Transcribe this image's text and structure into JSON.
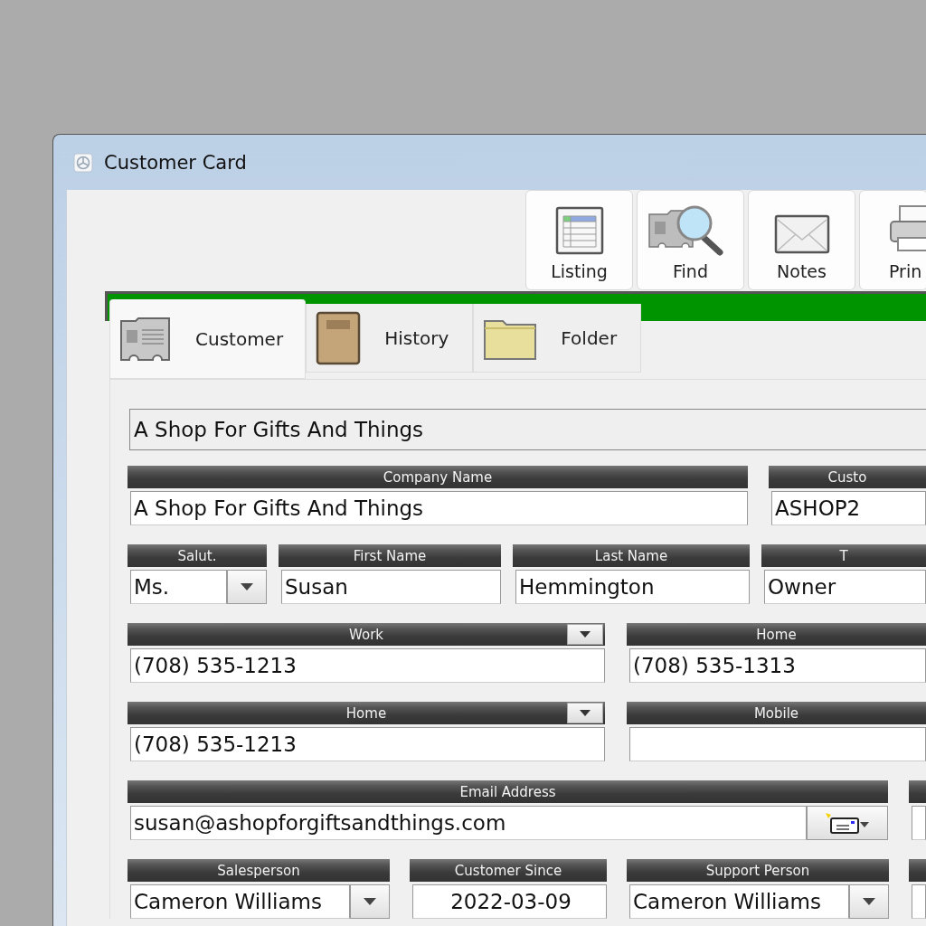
{
  "window": {
    "title": "Customer Card"
  },
  "toolbar": [
    {
      "label": "Listing",
      "kind": "listing"
    },
    {
      "label": "Find",
      "kind": "find"
    },
    {
      "label": "Notes",
      "kind": "notes"
    },
    {
      "label": "Prin",
      "kind": "print"
    }
  ],
  "tabs": [
    {
      "label": "Customer",
      "kind": "card",
      "selected": true
    },
    {
      "label": "History",
      "kind": "book",
      "selected": false
    },
    {
      "label": "Folder",
      "kind": "folder",
      "selected": false
    }
  ],
  "display_name": "A Shop For Gifts And Things",
  "rows": [
    [
      {
        "label": "Company Name",
        "value": "A Shop For Gifts And Things",
        "kind": "text"
      },
      {
        "label": "Custo",
        "value": "ASHOP2",
        "kind": "text"
      }
    ],
    [
      {
        "label": "Salut.",
        "value": "Ms.",
        "kind": "dropdown"
      },
      {
        "label": "First Name",
        "value": "Susan",
        "kind": "text"
      },
      {
        "label": "Last Name",
        "value": "Hemmington",
        "kind": "text"
      },
      {
        "label": "T",
        "value": "Owner",
        "kind": "text"
      }
    ],
    [
      {
        "label": "Work",
        "value": "(708) 535-1213",
        "kind": "text",
        "label_dropdown": true
      },
      {
        "label": "Home",
        "value": "(708) 535-1313",
        "kind": "text"
      }
    ],
    [
      {
        "label": "Home",
        "value": "(708) 535-1213",
        "kind": "text",
        "label_dropdown": true
      },
      {
        "label": "Mobile",
        "kind": "text"
      }
    ],
    [
      {
        "label": "Email Address",
        "value": "susan@ashopforgiftsandthings.com",
        "kind": "email"
      },
      {
        "kind": "text"
      }
    ],
    [
      {
        "label": "Salesperson",
        "value": "Cameron Williams",
        "kind": "dropdown"
      },
      {
        "label": "Customer Since",
        "value": "2022-03-09",
        "kind": "date"
      },
      {
        "label": "Support Person",
        "value": "Cameron Williams",
        "kind": "dropdown"
      },
      {
        "kind": "text"
      }
    ]
  ]
}
